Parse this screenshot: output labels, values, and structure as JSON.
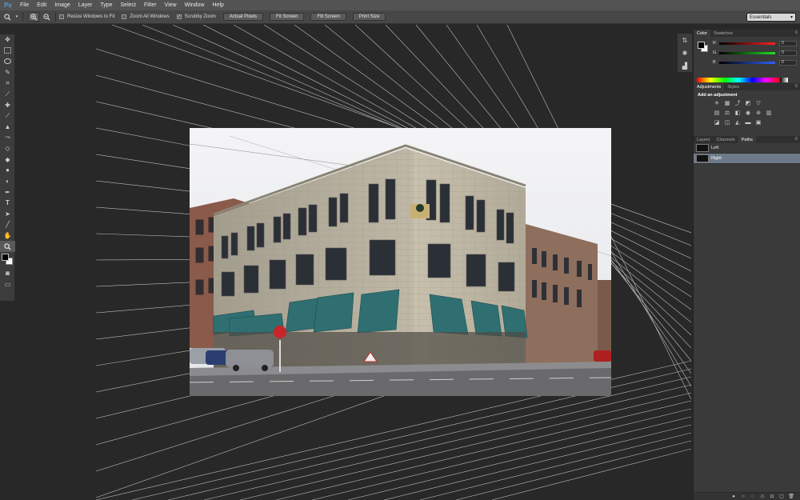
{
  "menubar": {
    "logo": "Ps",
    "items": [
      "File",
      "Edit",
      "Image",
      "Layer",
      "Type",
      "Select",
      "Filter",
      "View",
      "Window",
      "Help"
    ]
  },
  "options": {
    "resize_windows": "Resize Windows to Fit",
    "zoom_all": "Zoom All Windows",
    "scrubby_zoom": "Scrubby Zoom",
    "btn_actual": "Actual Pixels",
    "btn_fit": "Fit Screen",
    "btn_fill": "Fill Screen",
    "btn_print": "Print Size",
    "workspace": "Essentials"
  },
  "color_panel": {
    "tabs": [
      "Color",
      "Swatches"
    ],
    "r_label": "R",
    "g_label": "G",
    "b_label": "B",
    "r_value": "0",
    "g_value": "0",
    "b_value": "0",
    "r_color": "#ff2020",
    "g_color": "#20e020",
    "b_color": "#3060ff"
  },
  "adjustments_panel": {
    "tabs": [
      "Adjustments",
      "Styles"
    ],
    "title": "Add an adjustment"
  },
  "layers_panel": {
    "tabs": [
      "Layers",
      "Channels",
      "Paths"
    ],
    "paths": [
      {
        "name": "Left",
        "selected": false
      },
      {
        "name": "Right",
        "selected": true
      }
    ]
  },
  "icons": {
    "zoom_tool": "magnifier-icon",
    "panel_menu": "panel-menu-icon"
  }
}
